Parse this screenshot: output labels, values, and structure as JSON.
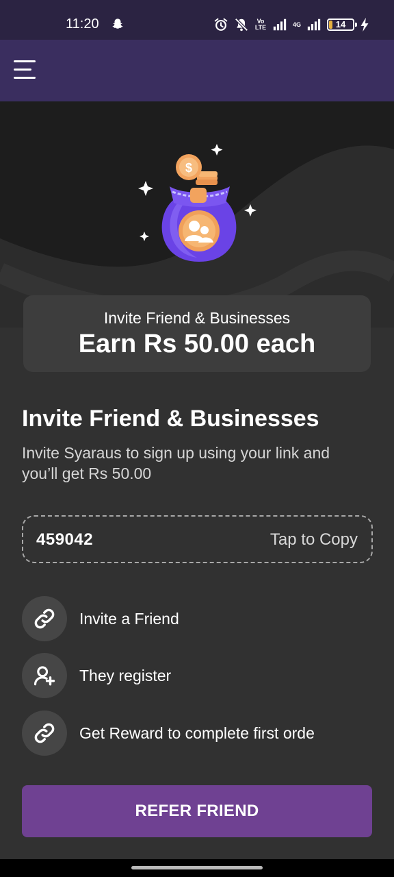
{
  "status_bar": {
    "time": "11:20",
    "volte": "Vo LTE",
    "network": "4G",
    "battery": "14",
    "battery_level": 0.14
  },
  "app_bar": {
    "menu_icon": "hamburger-menu-icon"
  },
  "hero": {
    "illustration": "money-bag-icon"
  },
  "earn_card": {
    "subtitle": "Invite Friend & Businesses",
    "headline": "Earn Rs 50.00 each"
  },
  "section": {
    "title": "Invite Friend & Businesses",
    "description": "Invite Syaraus to sign up using your link and you’ll get Rs 50.00"
  },
  "referral": {
    "code": "459042",
    "copy_label": "Tap to Copy"
  },
  "steps": [
    {
      "icon": "link-icon",
      "label": "Invite a Friend"
    },
    {
      "icon": "user-add-icon",
      "label": "They register"
    },
    {
      "icon": "link-icon",
      "label": "Get Reward to complete first orde"
    }
  ],
  "cta": {
    "label": "REFER FRIEND"
  },
  "colors": {
    "status_bg": "#2b2342",
    "appbar_bg": "#3a2e5f",
    "page_bg": "#313131",
    "accent": "#6f4192"
  }
}
